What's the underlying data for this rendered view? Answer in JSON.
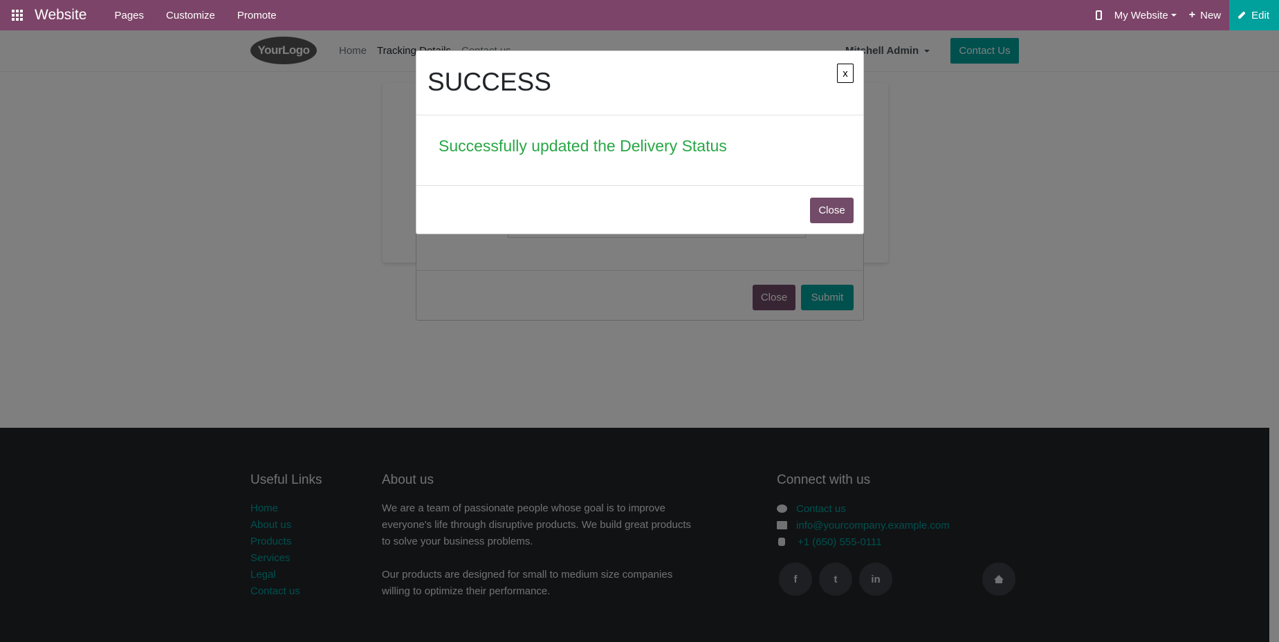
{
  "topbar": {
    "brand": "Website",
    "menu": [
      "Pages",
      "Customize",
      "Promote"
    ],
    "website_switcher": "My Website",
    "new_label": "New",
    "edit_label": "Edit"
  },
  "site_header": {
    "logo_text": "YourLogo",
    "nav": [
      "Home",
      "Tracking Details",
      "Contact us"
    ],
    "user": "Mitchell Admin",
    "cta": "Contact Us"
  },
  "form_modal": {
    "close_label": "Close",
    "submit_label": "Submit"
  },
  "success_modal": {
    "title": "SUCCESS",
    "x_label": "x",
    "message": "Successfully updated the Delivery Status",
    "close_label": "Close"
  },
  "footer": {
    "useful_links_title": "Useful Links",
    "useful_links": [
      "Home",
      "About us",
      "Products",
      "Services",
      "Legal",
      "Contact us"
    ],
    "about_title": "About us",
    "about_p1": "We are a team of passionate people whose goal is to improve everyone's life through disruptive products. We build great products to solve your business problems.",
    "about_p2": "Our products are designed for small to medium size companies willing to optimize their performance.",
    "connect_title": "Connect with us",
    "connect": {
      "contact": "Contact us",
      "email": "info@yourcompany.example.com",
      "phone": "+1 (650) 555-0111"
    },
    "social": [
      "f",
      "t",
      "in"
    ]
  },
  "colors": {
    "topbar": "#7c4468",
    "edit_button": "#00a09d",
    "primary": "#714b67",
    "success_text": "#28a745"
  }
}
